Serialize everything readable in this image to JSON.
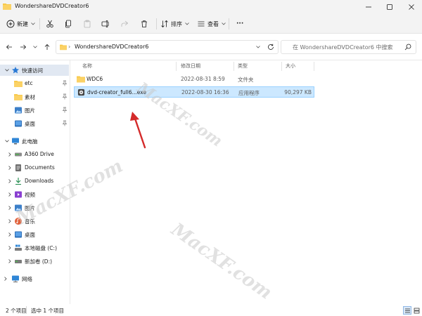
{
  "window": {
    "title": "WondershareDVDCreator6"
  },
  "toolbar": {
    "new_label": "新建",
    "sort_label": "排序",
    "view_label": "查看",
    "more_label": "···"
  },
  "address": {
    "path": "WondershareDVDCreator6",
    "crumb_sep": "›"
  },
  "search": {
    "placeholder": "在 WondershareDVDCreator6 中搜索"
  },
  "sidebar": {
    "items": [
      {
        "label": "快速访问"
      },
      {
        "label": "etc"
      },
      {
        "label": "素材"
      },
      {
        "label": "图片"
      },
      {
        "label": "桌面"
      },
      {
        "label": "此电脑"
      },
      {
        "label": "A360 Drive"
      },
      {
        "label": "Documents"
      },
      {
        "label": "Downloads"
      },
      {
        "label": "视频"
      },
      {
        "label": "图片"
      },
      {
        "label": "音乐"
      },
      {
        "label": "桌面"
      },
      {
        "label": "本地磁盘 (C:)"
      },
      {
        "label": "新加卷 (D:)"
      },
      {
        "label": "网络"
      }
    ]
  },
  "columns": {
    "name": "名称",
    "modified": "修改日期",
    "type": "类型",
    "size": "大小"
  },
  "files": [
    {
      "name": "WDC6",
      "modified": "2022-08-31 8:59",
      "type": "文件夹",
      "size": ""
    },
    {
      "name": "dvd-creator_full6...exe",
      "modified": "2022-08-30 16:36",
      "type": "应用程序",
      "size": "90,297 KB"
    }
  ],
  "status": {
    "count": "2 个项目",
    "selected": "选中 1 个项目"
  },
  "watermark": "MacXF.com",
  "colors": {
    "accent": "#0067c0",
    "selection": "#cce8ff",
    "folder": "#f8c94a"
  }
}
